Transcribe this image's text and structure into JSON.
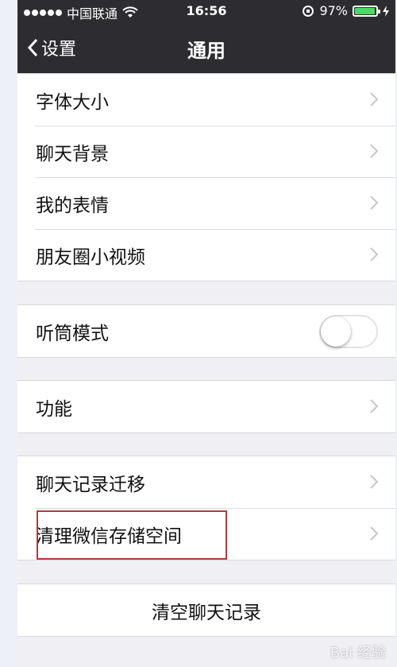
{
  "status_bar": {
    "carrier": "中国联通",
    "time": "16:56",
    "battery_percent": "97%",
    "battery_level": 0.97,
    "colors": {
      "battery_fill": "#4cd964"
    }
  },
  "nav": {
    "back_label": "设置",
    "title": "通用"
  },
  "group1": {
    "items": [
      {
        "label": "字体大小"
      },
      {
        "label": "聊天背景"
      },
      {
        "label": "我的表情"
      },
      {
        "label": "朋友圈小视频"
      }
    ]
  },
  "group2": {
    "items": [
      {
        "label": "听筒模式",
        "toggle_on": false
      }
    ]
  },
  "group3": {
    "items": [
      {
        "label": "功能"
      }
    ]
  },
  "group4": {
    "items": [
      {
        "label": "聊天记录迁移"
      },
      {
        "label": "清理微信存储空间"
      }
    ]
  },
  "group5": {
    "button_label": "清空聊天记录"
  },
  "watermark": "Bai 经验",
  "accent_colors": {
    "highlight_border": "#b53a3a",
    "bar_background": "#2d2d31"
  }
}
